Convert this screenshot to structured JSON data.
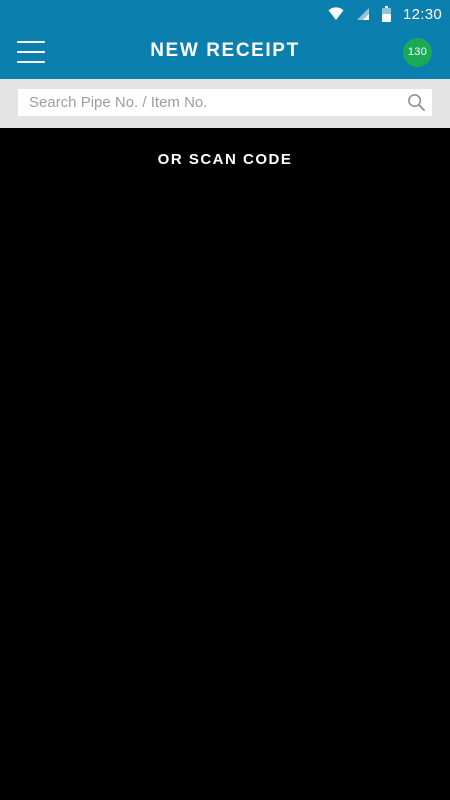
{
  "status_bar": {
    "time": "12:30",
    "icons": [
      "wifi-icon",
      "cellular-signal-icon",
      "battery-icon"
    ]
  },
  "app_bar": {
    "title": "NEW RECEIPT",
    "badge_count": "130",
    "menu_icon": "hamburger-menu-icon"
  },
  "search": {
    "placeholder": "Search Pipe No. / Item No.",
    "value": "",
    "icon": "search-icon"
  },
  "scan": {
    "label": "OR SCAN CODE"
  },
  "colors": {
    "primary": "#0b7fae",
    "badge": "#1aaa55",
    "search_background": "#e4e4e4",
    "scan_background": "#000000"
  }
}
